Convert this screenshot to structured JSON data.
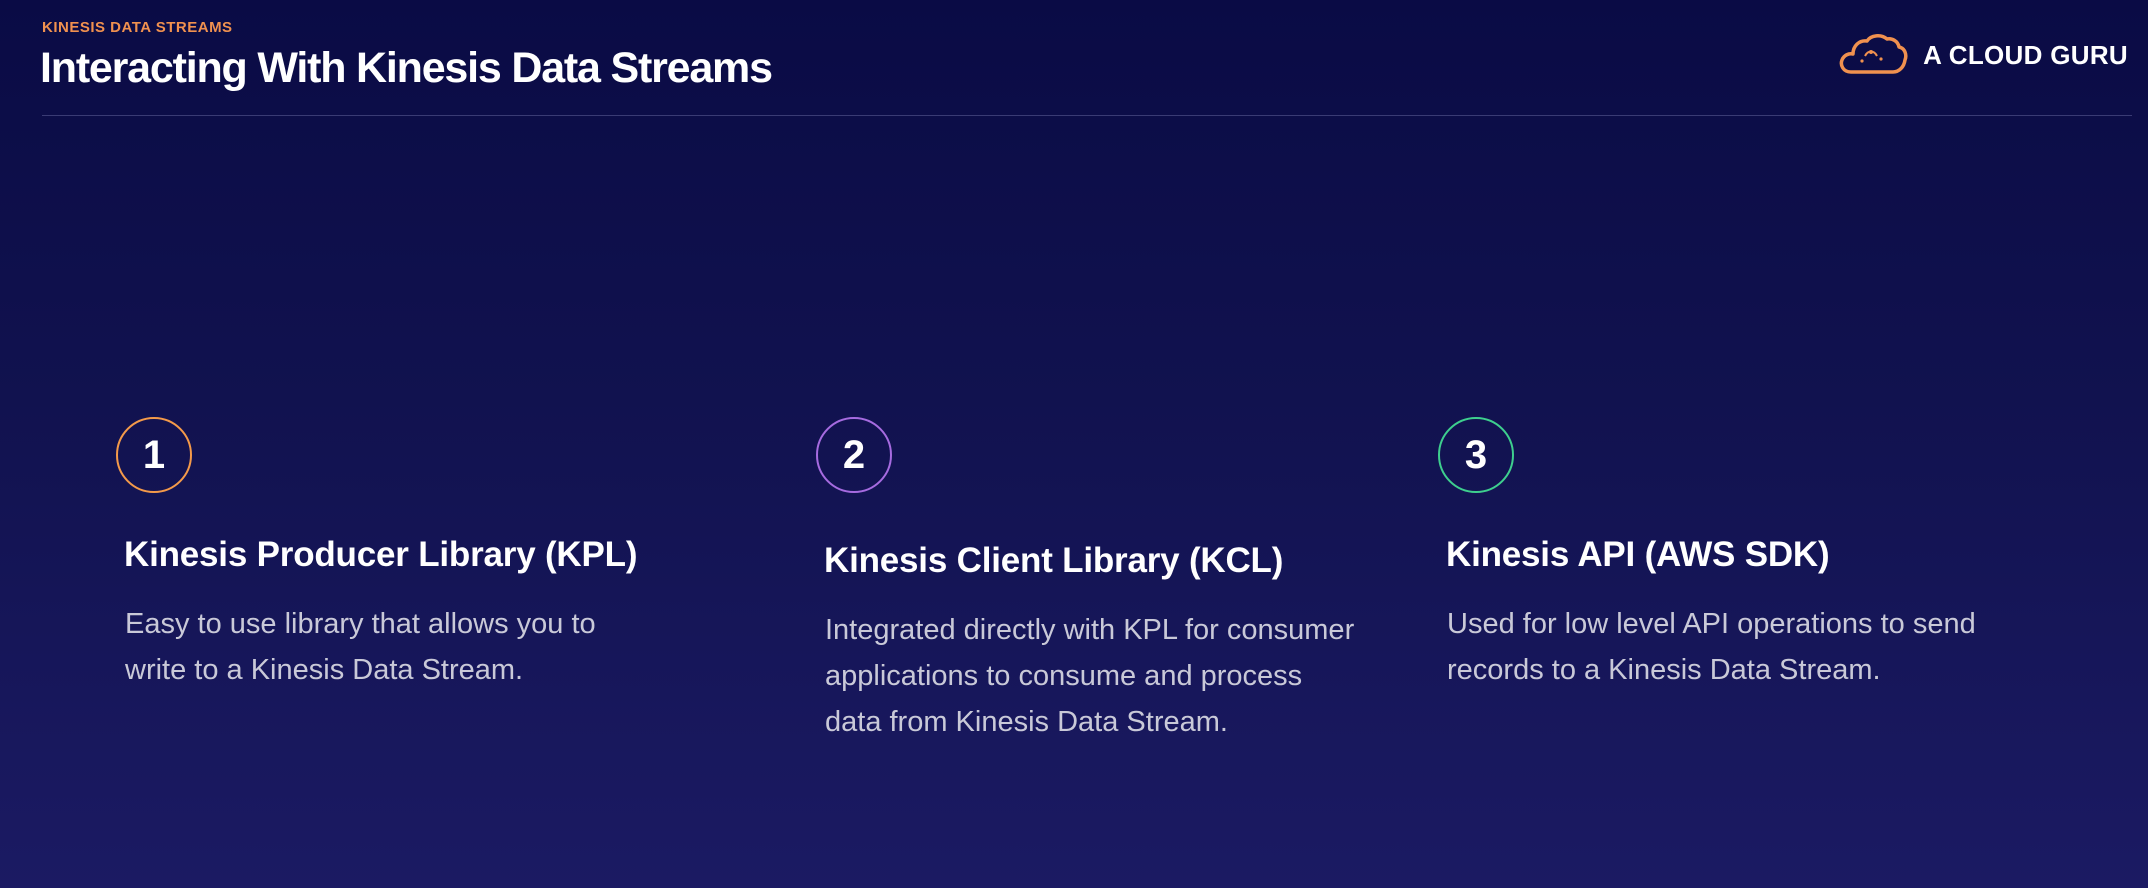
{
  "header": {
    "eyebrow": "KINESIS DATA STREAMS",
    "title": "Interacting With Kinesis Data Streams"
  },
  "brand": {
    "name": "A CLOUD GURU",
    "icon": "cloud-logo-icon",
    "accent": "#f0914f"
  },
  "columns": [
    {
      "number": "1",
      "ring_color": "#f49a4a",
      "title": "Kinesis Producer Library (KPL)",
      "description": "Easy to use library that allows you to write to a Kinesis Data Stream."
    },
    {
      "number": "2",
      "ring_color": "#a66be0",
      "title": "Kinesis Client Library (KCL)",
      "description": "Integrated directly with KPL for consumer applications to consume and process data from Kinesis Data Stream."
    },
    {
      "number": "3",
      "ring_color": "#3ecf8e",
      "title": "Kinesis API (AWS SDK)",
      "description": "Used for low level API operations to send records to a Kinesis Data Stream."
    }
  ]
}
